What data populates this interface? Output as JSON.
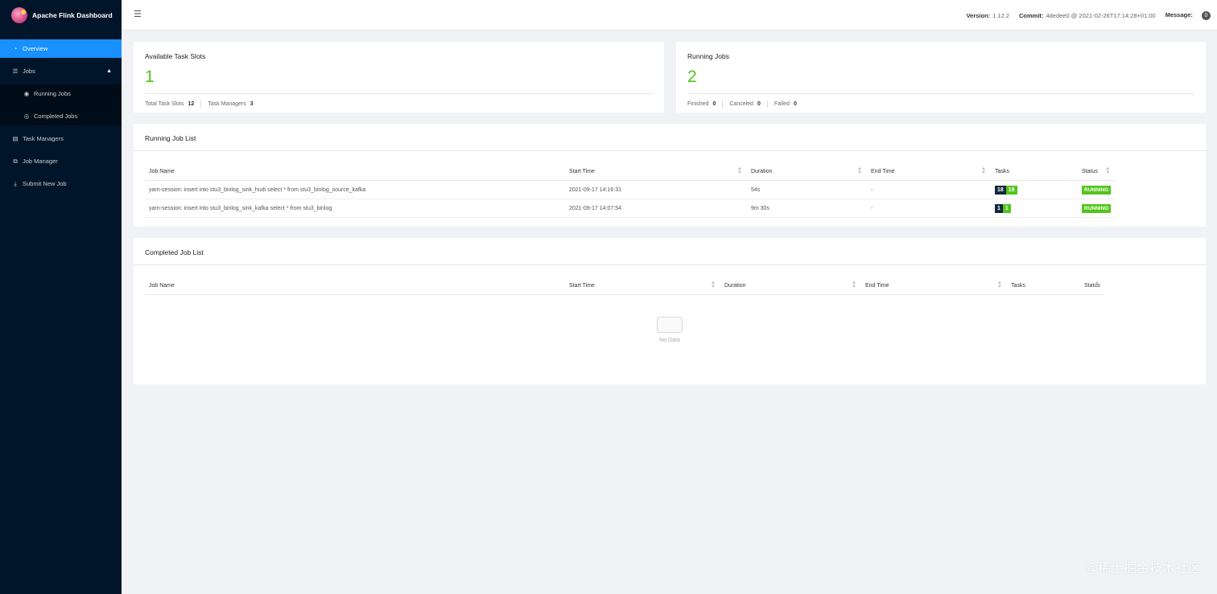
{
  "app": {
    "title": "Apache Flink Dashboard"
  },
  "sidebar": {
    "items": [
      {
        "label": "Overview",
        "icon": "dashboard-icon"
      },
      {
        "label": "Jobs",
        "icon": "list-icon"
      },
      {
        "label": "Running Jobs",
        "icon": "play-circle-icon"
      },
      {
        "label": "Completed Jobs",
        "icon": "check-circle-icon"
      },
      {
        "label": "Task Managers",
        "icon": "server-icon"
      },
      {
        "label": "Job Manager",
        "icon": "cluster-icon"
      },
      {
        "label": "Submit New Job",
        "icon": "upload-icon"
      }
    ]
  },
  "header": {
    "version_label": "Version:",
    "version": "1.12.2",
    "commit_label": "Commit:",
    "commit": "4dedee0 @ 2021-02-26T17:14:28+01:00",
    "message_label": "Message:",
    "message_count": "0"
  },
  "task_slots": {
    "title": "Available Task Slots",
    "value": "1",
    "total_label": "Total Task Slots",
    "total": "12",
    "tm_label": "Task Managers",
    "tm": "3"
  },
  "running_jobs_card": {
    "title": "Running Jobs",
    "value": "2",
    "finished_label": "Finished",
    "finished": "0",
    "canceled_label": "Canceled",
    "canceled": "0",
    "failed_label": "Failed",
    "failed": "0"
  },
  "running_list": {
    "title": "Running Job List",
    "columns": [
      "Job Name",
      "Start Time",
      "Duration",
      "End Time",
      "Tasks",
      "Status"
    ],
    "rows": [
      {
        "name": "yarn-session: insert into stu3_binlog_sink_hudi select * from stu3_binlog_source_kafka",
        "start": "2021-09-17 14:16:31",
        "duration": "54s",
        "end": "-",
        "tasks_total": "18",
        "tasks_running": "18",
        "status": "RUNNING"
      },
      {
        "name": "yarn-session: insert into stu3_binlog_sink_kafka select * from stu3_binlog",
        "start": "2021-09-17 14:07:54",
        "duration": "9m 30s",
        "end": "-",
        "tasks_total": "1",
        "tasks_running": "1",
        "status": "RUNNING"
      }
    ]
  },
  "completed_list": {
    "title": "Completed Job List",
    "columns": [
      "Job Name",
      "Start Time",
      "Duration",
      "End Time",
      "Tasks",
      "Status"
    ],
    "empty_text": "No Data"
  },
  "watermark": "@稀土掘金技术社区",
  "colors": {
    "sidebar": "#001529",
    "active": "#1890ff",
    "success": "#52c41a"
  }
}
